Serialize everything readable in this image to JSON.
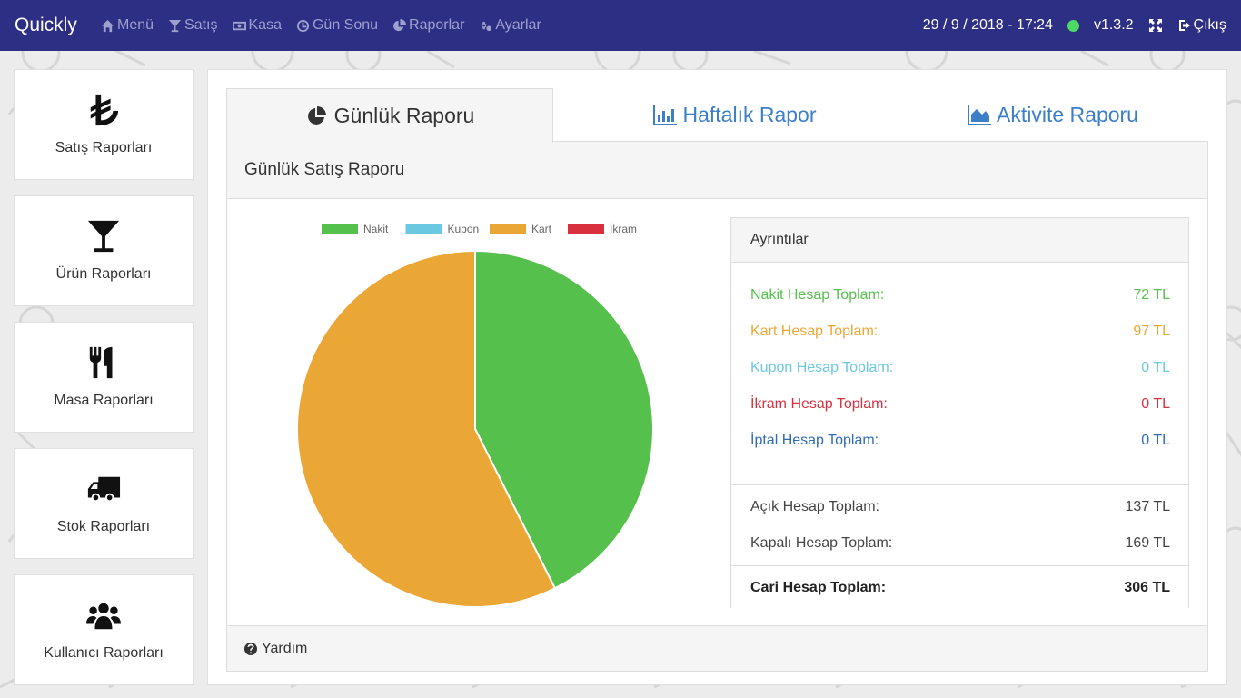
{
  "app": {
    "brand": "Quickly"
  },
  "nav": {
    "items": [
      {
        "label": "Menü",
        "icon": "home-icon"
      },
      {
        "label": "Satış",
        "icon": "cocktail-icon"
      },
      {
        "label": "Kasa",
        "icon": "money-icon"
      },
      {
        "label": "Gün Sonu",
        "icon": "clock-icon"
      },
      {
        "label": "Raporlar",
        "icon": "pie-chart-icon"
      },
      {
        "label": "Ayarlar",
        "icon": "gears-icon"
      }
    ],
    "datetime": "29 / 9 / 2018 - 17:24",
    "version": "v1.3.2",
    "logout": "Çıkış",
    "status_color": "#4cd964"
  },
  "sidebar": {
    "items": [
      {
        "label": "Satış Raporları",
        "icon": "lira-icon"
      },
      {
        "label": "Ürün Raporları",
        "icon": "cocktail-icon"
      },
      {
        "label": "Masa Raporları",
        "icon": "cutlery-icon"
      },
      {
        "label": "Stok Raporları",
        "icon": "truck-icon"
      },
      {
        "label": "Kullanıcı Raporları",
        "icon": "users-icon"
      }
    ]
  },
  "tabs": [
    {
      "label": "Günlük Raporu",
      "icon": "pie-chart-icon",
      "active": true
    },
    {
      "label": "Haftalık Rapor",
      "icon": "bar-chart-icon",
      "active": false
    },
    {
      "label": "Aktivite Raporu",
      "icon": "area-chart-icon",
      "active": false
    }
  ],
  "panel": {
    "title": "Günlük Satış Raporu",
    "footer": "Yardım"
  },
  "details": {
    "title": "Ayrıntılar",
    "rows": [
      {
        "label": "Nakit Hesap Toplam:",
        "value": "72 TL",
        "color": "#56c04d"
      },
      {
        "label": "Kart Hesap Toplam:",
        "value": "97 TL",
        "color": "#eba736"
      },
      {
        "label": "Kupon Hesap Toplam:",
        "value": "0 TL",
        "color": "#6bc8e2"
      },
      {
        "label": "İkram Hesap Toplam:",
        "value": "0 TL",
        "color": "#d9303e"
      },
      {
        "label": "İptal Hesap Toplam:",
        "value": "0 TL",
        "color": "#2f6cb6"
      }
    ],
    "open_label": "Açık Hesap Toplam:",
    "open_value": "137 TL",
    "closed_label": "Kapalı Hesap Toplam:",
    "closed_value": "169 TL",
    "current_label": "Cari Hesap Toplam:",
    "current_value": "306 TL"
  },
  "chart_data": {
    "type": "pie",
    "title": "",
    "legend_position": "top",
    "series": [
      {
        "name": "Nakit",
        "value": 72,
        "color": "#56c04d"
      },
      {
        "name": "Kupon",
        "value": 0,
        "color": "#6bc8e2"
      },
      {
        "name": "Kart",
        "value": 97,
        "color": "#eba736"
      },
      {
        "name": "İkram",
        "value": 0,
        "color": "#d9303e"
      }
    ]
  }
}
